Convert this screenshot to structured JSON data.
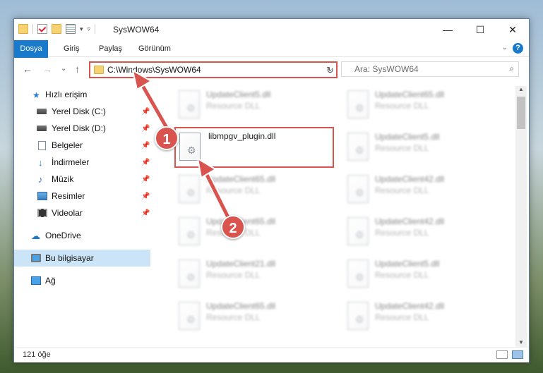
{
  "window": {
    "title": "SysWOW64",
    "controls": {
      "minimize": "—",
      "maximize": "☐",
      "close": "✕"
    }
  },
  "ribbon": {
    "tabs": [
      "Dosya",
      "Giriş",
      "Paylaş",
      "Görünüm"
    ],
    "collapse": "⌄",
    "help": "?"
  },
  "nav": {
    "back": "←",
    "forward": "→",
    "recent": "⌄",
    "up": "↑",
    "address": "C:\\Windows\\SysWOW64",
    "address_dropdown": "⌄",
    "refresh": "↻",
    "search_placeholder": "Ara: SysWOW64",
    "search_icon": "⌕"
  },
  "sidebar": {
    "items": [
      {
        "label": "Hızlı erişim",
        "icon": "star-icon",
        "pinned": false
      },
      {
        "label": "Yerel Disk (C:)",
        "icon": "disk-icon",
        "pinned": true
      },
      {
        "label": "Yerel Disk (D:)",
        "icon": "disk-icon",
        "pinned": true
      },
      {
        "label": "Belgeler",
        "icon": "document-icon",
        "pinned": true
      },
      {
        "label": "İndirmeler",
        "icon": "download-icon",
        "pinned": true
      },
      {
        "label": "Müzik",
        "icon": "music-icon",
        "pinned": true
      },
      {
        "label": "Resimler",
        "icon": "pictures-icon",
        "pinned": true
      },
      {
        "label": "Videolar",
        "icon": "videos-icon",
        "pinned": true
      },
      {
        "label": "OneDrive",
        "icon": "cloud-icon",
        "pinned": false
      },
      {
        "label": "Bu bilgisayar",
        "icon": "computer-icon",
        "pinned": false,
        "selected": true
      },
      {
        "label": "Ağ",
        "icon": "network-icon",
        "pinned": false
      }
    ],
    "pin_glyph": "📌"
  },
  "files": {
    "left": [
      {
        "name": "UpdateClient5.dll",
        "type": "Resource DLL"
      },
      {
        "name": "libmpgv_plugin.dll",
        "type": "",
        "highlighted": true
      },
      {
        "name": "UpdateClient65.dll",
        "type": "Resource DLL"
      },
      {
        "name": "UpdateClient65.dll",
        "type": "Resource DLL"
      },
      {
        "name": "UpdateClient21.dll",
        "type": "Resource DLL"
      },
      {
        "name": "UpdateClient65.dll",
        "type": "Resource DLL"
      }
    ],
    "right": [
      {
        "name": "UpdateClient65.dll",
        "type": "Resource DLL"
      },
      {
        "name": "UpdateClient5.dll",
        "type": "Resource DLL"
      },
      {
        "name": "UpdateClient42.dll",
        "type": "Resource DLL"
      },
      {
        "name": "UpdateClient42.dll",
        "type": "Resource DLL"
      },
      {
        "name": "UpdateClient5.dll",
        "type": "Resource DLL"
      },
      {
        "name": "UpdateClient42.dll",
        "type": "Resource DLL"
      }
    ]
  },
  "status": {
    "item_count": "121 öğe"
  },
  "annotations": {
    "step1": "1",
    "step2": "2",
    "accent": "#d9534f"
  }
}
